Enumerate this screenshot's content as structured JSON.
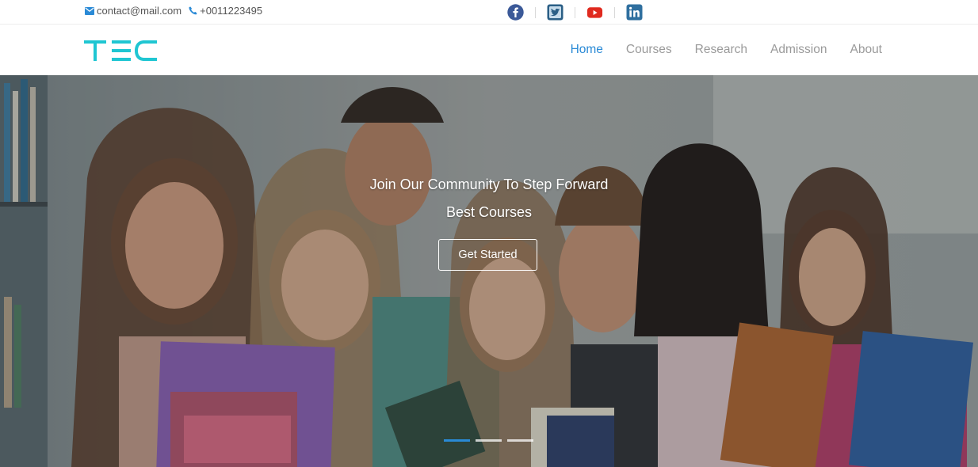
{
  "topbar": {
    "email": "contact@mail.com",
    "phone": "+0011223495",
    "email_icon": "envelope-icon",
    "phone_icon": "phone-icon",
    "social": [
      "facebook-icon",
      "twitter-icon",
      "youtube-icon",
      "linkedin-icon"
    ]
  },
  "brand": {
    "logo": "TEC",
    "color": "#1fc6d2"
  },
  "nav": {
    "items": [
      {
        "label": "Home",
        "active": true
      },
      {
        "label": "Courses",
        "active": false
      },
      {
        "label": "Research",
        "active": false
      },
      {
        "label": "Admission",
        "active": false
      },
      {
        "label": "About",
        "active": false
      }
    ],
    "active_color": "#2a8ad6"
  },
  "hero": {
    "title": "Join Our Community To Step Forward",
    "subtitle": "Best Courses",
    "cta": "Get Started",
    "slides": 3,
    "active_slide": 1
  }
}
